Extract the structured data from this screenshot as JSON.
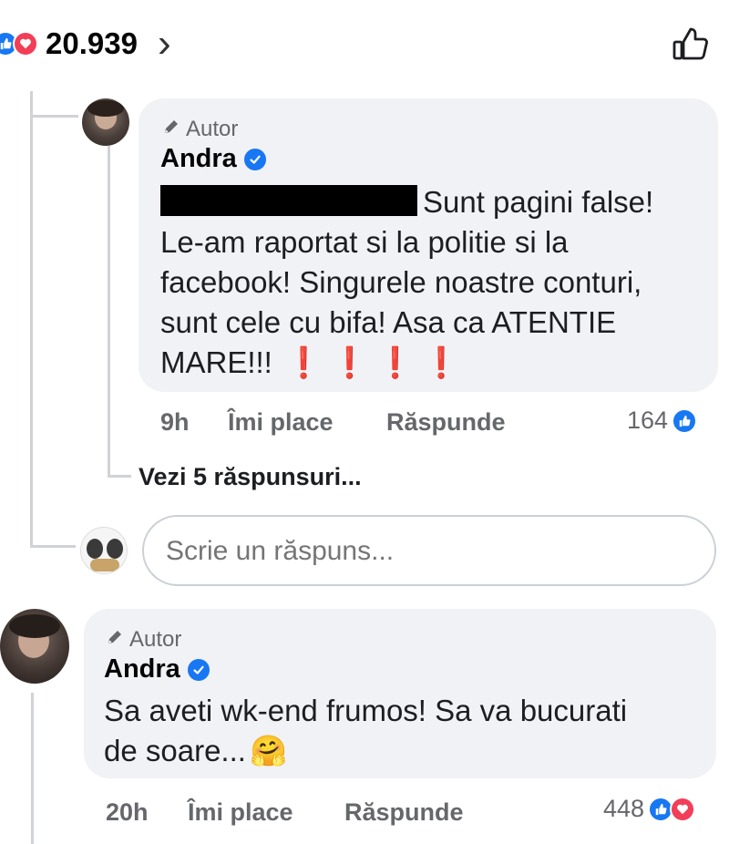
{
  "header": {
    "reaction_count": "20.939",
    "chevron_glyph": "›"
  },
  "comments": [
    {
      "author_tag": "Autor",
      "author_name": "Andra",
      "text_after_redaction": "Sunt pagini false!",
      "text_lines": [
        "Le-am raportat si la politie si la",
        "facebook! Singurele noastre conturi,",
        "sunt cele cu bifa! Asa ca ATENTIE"
      ],
      "last_line": "MARE!!!",
      "emoji_marks": "❗ ❗ ❗ ❗",
      "time": "9h",
      "like_label": "Îmi place",
      "reply_label": "Răspunde",
      "reaction_count": "164"
    },
    {
      "author_tag": "Autor",
      "author_name": "Andra",
      "text_lines": [
        "Sa aveti wk-end frumos! Sa va bucurati",
        "de soare..."
      ],
      "emoji": "🤗",
      "time": "20h",
      "like_label": "Îmi place",
      "reply_label": "Răspunde",
      "reaction_count": "448"
    }
  ],
  "view_replies": "Vezi 5 răspunsuri...",
  "reply_input": {
    "placeholder": "Scrie un răspuns..."
  },
  "colors": {
    "like_blue": "#1877f2",
    "love_red": "#f33e58",
    "bubble_gray": "#f0f2f5"
  }
}
